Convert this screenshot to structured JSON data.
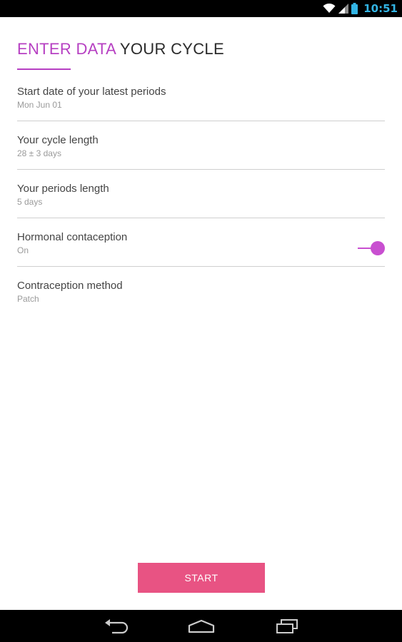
{
  "status_bar": {
    "time": "10:51",
    "icons": [
      "wifi-icon",
      "signal-icon",
      "battery-icon"
    ],
    "time_color": "#33b5e5"
  },
  "header": {
    "title_accent": "ENTER DATA",
    "title_rest": " YOUR CYCLE",
    "accent_color": "#b63fc2"
  },
  "settings": [
    {
      "label": "Start date of your latest periods",
      "value": "Mon Jun 01"
    },
    {
      "label": "Your cycle length",
      "value": "28 ± 3 days"
    },
    {
      "label": "Your periods length",
      "value": "5 days"
    },
    {
      "label": "Hormonal contaception",
      "value": "On",
      "toggle_on": true
    },
    {
      "label": "Contraception method",
      "value": "Patch"
    }
  ],
  "actions": {
    "start_label": "START",
    "start_color": "#e85383"
  },
  "nav_bar": {
    "icons": [
      "back-icon",
      "home-icon",
      "recent-apps-icon"
    ]
  }
}
